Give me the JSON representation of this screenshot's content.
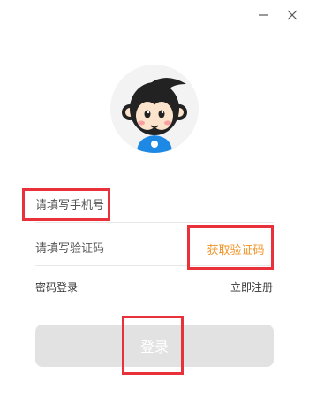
{
  "window_controls": {
    "minimize_icon": "minimize-icon",
    "close_icon": "close-icon"
  },
  "avatar": {
    "icon": "monkey-mascot-icon",
    "colors": {
      "background": "#f3f3f3",
      "fur": "#222222",
      "face": "#fce3cc",
      "shirt": "#1e88e5"
    }
  },
  "phone_field": {
    "placeholder": "请填写手机号",
    "value": ""
  },
  "code_field": {
    "placeholder": "请填写验证码",
    "value": ""
  },
  "get_code_label": "获取验证码",
  "password_login_label": "密码登录",
  "register_label": "立即注册",
  "login_button_label": "登录",
  "colors": {
    "accent": "#f0952a",
    "highlight": "#e8313a",
    "button_disabled": "#e2e2e2",
    "divider": "#e8e8e8"
  }
}
